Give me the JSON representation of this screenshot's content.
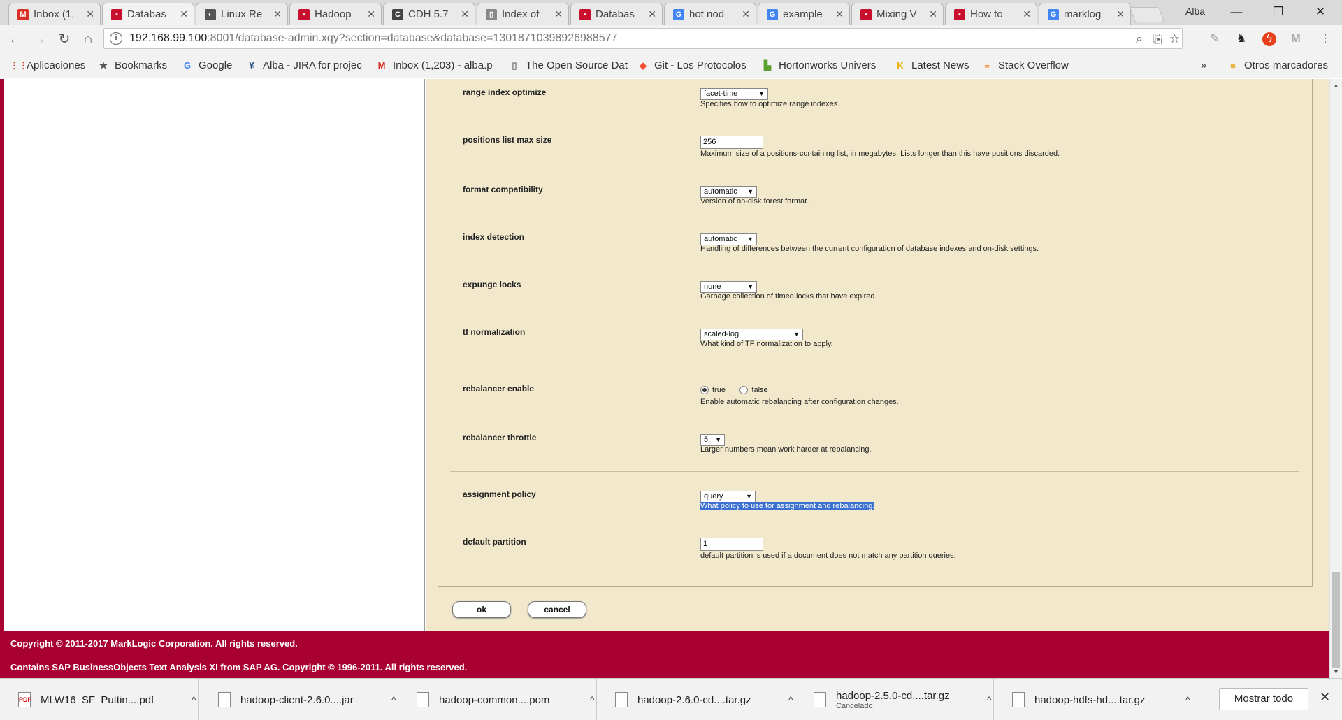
{
  "browser": {
    "tabs": [
      {
        "title": "Inbox (1,",
        "icon": "gmail-icon",
        "icon_glyph": "M",
        "icon_color": "#d93025"
      },
      {
        "title": "Databas",
        "icon": "marklogic-icon",
        "icon_glyph": "▪",
        "icon_color": "#c8102e"
      },
      {
        "title": "Linux Re",
        "icon": "linux-icon",
        "icon_glyph": "◐",
        "icon_color": "#555555"
      },
      {
        "title": "Hadoop",
        "icon": "marklogic-icon",
        "icon_glyph": "▪",
        "icon_color": "#c8102e"
      },
      {
        "title": "CDH 5.7",
        "icon": "cloudera-icon",
        "icon_glyph": "C",
        "icon_color": "#444444"
      },
      {
        "title": "Index of",
        "icon": "page-icon",
        "icon_glyph": "▯",
        "icon_color": "#888888"
      },
      {
        "title": "Databas",
        "icon": "marklogic-icon",
        "icon_glyph": "▪",
        "icon_color": "#c8102e"
      },
      {
        "title": "hot nod",
        "icon": "google-icon",
        "icon_glyph": "G",
        "icon_color": "#4285f4"
      },
      {
        "title": "example",
        "icon": "google-icon",
        "icon_glyph": "G",
        "icon_color": "#4285f4"
      },
      {
        "title": "Mixing V",
        "icon": "marklogic-icon",
        "icon_glyph": "▪",
        "icon_color": "#c8102e"
      },
      {
        "title": "How to",
        "icon": "marklogic-icon",
        "icon_glyph": "▪",
        "icon_color": "#c8102e"
      },
      {
        "title": "marklog",
        "icon": "google-icon",
        "icon_glyph": "G",
        "icon_color": "#4285f4"
      }
    ],
    "profile_name": "Alba",
    "url_host": "192.168.99.100",
    "url_rest": ":8001/database-admin.xqy?section=database&database=13018710398926988577",
    "bookmarks": [
      {
        "label": "Aplicaciones",
        "icon": "apps-grid-icon",
        "glyph": "⋮⋮",
        "color": "#d93025"
      },
      {
        "label": "Bookmarks",
        "icon": "star-icon",
        "glyph": "★",
        "color": "#555555"
      },
      {
        "label": "Google",
        "icon": "google-icon",
        "glyph": "G",
        "color": "#4285f4"
      },
      {
        "label": "Alba - JIRA for projec",
        "icon": "jira-icon",
        "glyph": "¥",
        "color": "#205081"
      },
      {
        "label": "Inbox (1,203) - alba.p",
        "icon": "gmail-icon",
        "glyph": "M",
        "color": "#d93025"
      },
      {
        "label": "The Open Source Dat",
        "icon": "page-icon",
        "glyph": "▯",
        "color": "#777777"
      },
      {
        "label": "Git - Los Protocolos",
        "icon": "git-icon",
        "glyph": "◆",
        "color": "#f05133"
      },
      {
        "label": "Hortonworks Univers",
        "icon": "hortonworks-icon",
        "glyph": "▙",
        "color": "#5aa02c"
      },
      {
        "label": "Latest News",
        "icon": "news-icon",
        "glyph": "K",
        "color": "#e8b000"
      },
      {
        "label": "Stack Overflow",
        "icon": "stackoverflow-icon",
        "glyph": "≡",
        "color": "#f48024"
      }
    ],
    "bookmarks_more": "»",
    "other_bookmarks": "Otros marcadores"
  },
  "form": {
    "range_index_optimize": {
      "label": "range index optimize",
      "value": "facet-time",
      "help": "Specifies how to optimize range indexes."
    },
    "positions_list_max_size": {
      "label": "positions list max size",
      "value": "256",
      "help": "Maximum size of a positions-containing list, in megabytes. Lists longer than this have positions discarded."
    },
    "format_compatibility": {
      "label": "format compatibility",
      "value": "automatic",
      "help": "Version of on-disk forest format."
    },
    "index_detection": {
      "label": "index detection",
      "value": "automatic",
      "help": "Handling of differences between the current configuration of database indexes and on-disk settings."
    },
    "expunge_locks": {
      "label": "expunge locks",
      "value": "none",
      "help": "Garbage collection of timed locks that have expired."
    },
    "tf_normalization": {
      "label": "tf normalization",
      "value": "scaled-log",
      "help": "What kind of TF normalization to apply."
    },
    "rebalancer_enable": {
      "label": "rebalancer enable",
      "opt_true": "true",
      "opt_false": "false",
      "selected": "true",
      "help": "Enable automatic rebalancing after configuration changes."
    },
    "rebalancer_throttle": {
      "label": "rebalancer throttle",
      "value": "5",
      "help": "Larger numbers mean work harder at rebalancing."
    },
    "assignment_policy": {
      "label": "assignment policy",
      "value": "query",
      "help": "What policy to use for assignment and rebalancing."
    },
    "default_partition": {
      "label": "default partition",
      "value": "1",
      "help": "default partition is used if a document does not match any partition queries."
    },
    "ok_label": "ok",
    "cancel_label": "cancel"
  },
  "footer": {
    "copyright": "Copyright © 2011-2017 MarkLogic Corporation. All rights reserved.",
    "sap": "Contains SAP BusinessObjects Text Analysis XI from SAP AG. Copyright © 1996-2011. All rights reserved."
  },
  "downloads": [
    {
      "name": "MLW16_SF_Puttin....pdf",
      "status": ""
    },
    {
      "name": "hadoop-client-2.6.0....jar",
      "status": ""
    },
    {
      "name": "hadoop-common....pom",
      "status": ""
    },
    {
      "name": "hadoop-2.6.0-cd....tar.gz",
      "status": ""
    },
    {
      "name": "hadoop-2.5.0-cd....tar.gz",
      "status": "Cancelado"
    },
    {
      "name": "hadoop-hdfs-hd....tar.gz",
      "status": ""
    }
  ],
  "download_show_all": "Mostrar todo",
  "colors": {
    "brand_red": "#a80032",
    "form_bg": "#f2e9cd",
    "selection": "#3b6fd0"
  }
}
